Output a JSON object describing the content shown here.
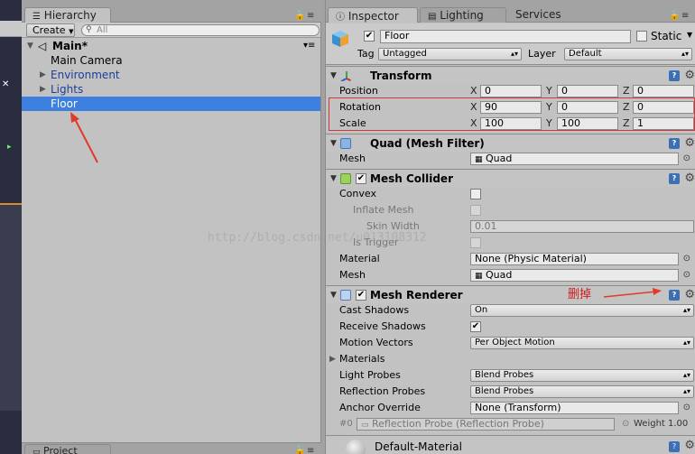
{
  "hierarchy": {
    "tab": "Hierarchy",
    "create_label": "Create",
    "search_placeholder": "All",
    "scene_name": "Main*",
    "items": [
      {
        "label": "Main Camera"
      },
      {
        "label": "Environment"
      },
      {
        "label": "Lights"
      },
      {
        "label": "Floor"
      }
    ]
  },
  "project": {
    "tab": "Project"
  },
  "inspector": {
    "tabs": [
      "Inspector",
      "Lighting",
      "Services"
    ],
    "object_name": "Floor",
    "static_label": "Static",
    "tag_label": "Tag",
    "tag_value": "Untagged",
    "layer_label": "Layer",
    "layer_value": "Default",
    "transform": {
      "title": "Transform",
      "position": {
        "label": "Position",
        "x": "0",
        "y": "0",
        "z": "0"
      },
      "rotation": {
        "label": "Rotation",
        "x": "90",
        "y": "0",
        "z": "0"
      },
      "scale": {
        "label": "Scale",
        "x": "100",
        "y": "100",
        "z": "1"
      },
      "axis_x": "X",
      "axis_y": "Y",
      "axis_z": "Z"
    },
    "mesh_filter": {
      "title": "Quad (Mesh Filter)",
      "mesh_label": "Mesh",
      "mesh_value": "Quad"
    },
    "mesh_collider": {
      "title": "Mesh Collider",
      "convex": "Convex",
      "inflate_mesh": "Inflate Mesh",
      "skin_width": "Skin Width",
      "skin_width_value": "0.01",
      "is_trigger": "Is Trigger",
      "material": "Material",
      "material_value": "None (Physic Material)",
      "mesh": "Mesh",
      "mesh_value": "Quad"
    },
    "mesh_renderer": {
      "title": "Mesh Renderer",
      "cast_shadows": "Cast Shadows",
      "cast_shadows_value": "On",
      "receive_shadows": "Receive Shadows",
      "motion_vectors": "Motion Vectors",
      "motion_vectors_value": "Per Object Motion",
      "materials": "Materials",
      "light_probes": "Light Probes",
      "light_probes_value": "Blend Probes",
      "reflection_probes": "Reflection Probes",
      "reflection_probes_value": "Blend Probes",
      "anchor_override": "Anchor Override",
      "anchor_override_value": "None (Transform)",
      "probe_index": "#0",
      "probe_value": "Reflection Probe (Reflection Probe)",
      "weight": "Weight 1.00"
    },
    "material_name": "Default-Material"
  },
  "annotation": {
    "text": "删掉"
  },
  "watermark": "http://blog.csdn.net/u013108312",
  "colors": {
    "selection": "#3d80df",
    "annotation": "#d0201a",
    "help_icon": "#3b70b4"
  }
}
